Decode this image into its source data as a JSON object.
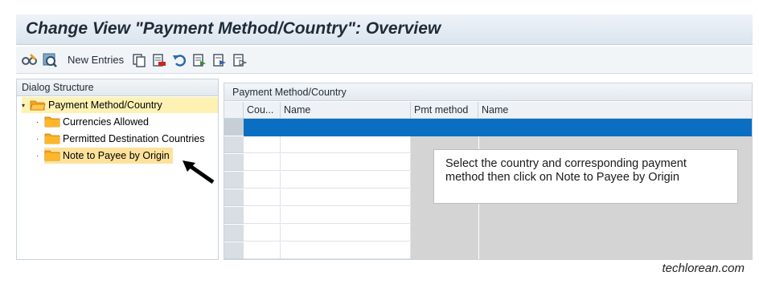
{
  "window": {
    "title": "Change View \"Payment Method/Country\": Overview"
  },
  "toolbar": {
    "items": [
      {
        "icon": "glasses-edit-icon"
      },
      {
        "icon": "display-change-icon"
      },
      {
        "label": "New Entries"
      },
      {
        "icon": "copy-icon"
      },
      {
        "icon": "delete-icon"
      },
      {
        "icon": "undo-icon"
      },
      {
        "icon": "select-all-icon"
      },
      {
        "icon": "select-block-icon"
      },
      {
        "icon": "deselect-all-icon"
      }
    ]
  },
  "dialog_structure": {
    "header": "Dialog Structure",
    "items": [
      {
        "label": "Payment Method/Country",
        "expanded": true,
        "level": 0
      },
      {
        "label": "Currencies Allowed",
        "level": 1
      },
      {
        "label": "Permitted Destination Countries",
        "level": 1
      },
      {
        "label": "Note to Payee by Origin",
        "level": 1,
        "selected": true
      }
    ]
  },
  "table": {
    "header": "Payment Method/Country",
    "columns": [
      "Cou...",
      "Name",
      "Pmt method",
      "Name"
    ]
  },
  "callout": {
    "text": "Select the country and corresponding payment method then click on Note to Payee by Origin"
  },
  "watermark": "techlorean.com",
  "colors": {
    "selection_blue": "#0a6fc2",
    "highlight_yellow": "#fde29c",
    "folder_orange": "#f5a623"
  }
}
